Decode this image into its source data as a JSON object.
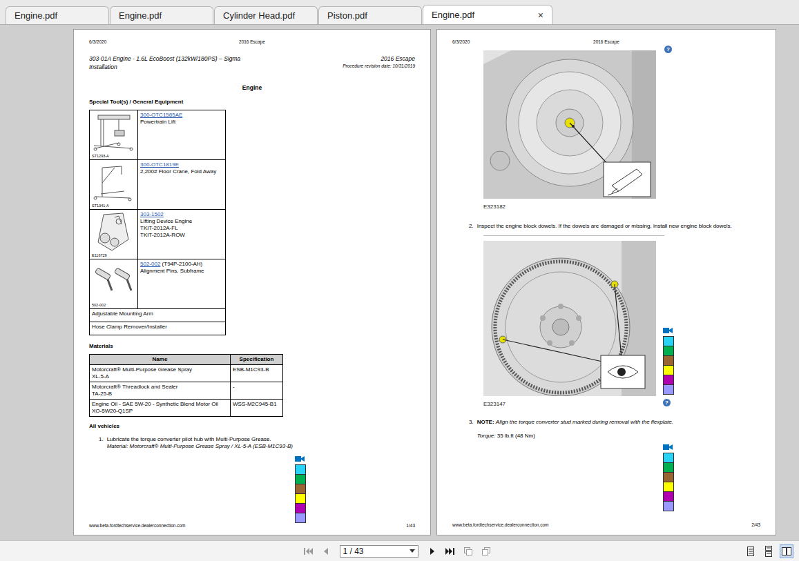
{
  "tabs": [
    {
      "label": "Engine.pdf",
      "selected": false
    },
    {
      "label": "Engine.pdf",
      "selected": false
    },
    {
      "label": "Cylinder Head.pdf",
      "selected": false
    },
    {
      "label": "Piston.pdf",
      "selected": false
    },
    {
      "label": "Engine.pdf",
      "selected": true,
      "close": "×"
    }
  ],
  "left_page": {
    "header": {
      "date": "6/3/2020",
      "center": "2016 Escape"
    },
    "title": {
      "left": [
        "303-01A Engine - 1.6L EcoBoost (132kW/180PS) – Sigma",
        "Installation"
      ],
      "right": [
        "2016 Escape",
        "Procedure revision date: 10/31/2019"
      ]
    },
    "section": "Engine",
    "tools_heading": "Special Tool(s) / General Equipment",
    "tools": [
      {
        "kind": "lift",
        "image_label": "ST1293-A",
        "link": "300-OTC1585AE",
        "link_suffix": "",
        "lines": [
          "Powertrain Lift"
        ]
      },
      {
        "kind": "crane",
        "image_label": "ST1341-A",
        "link": "300-OTC1819E",
        "link_suffix": "",
        "lines": [
          "2,200# Floor Crane, Fold Away"
        ]
      },
      {
        "kind": "bracket",
        "image_label": "E116729",
        "link": "303-1502",
        "link_suffix": "",
        "lines": [
          "Lifting Device Engine",
          "TKIT-2012A-FL",
          "TKIT-2012A-ROW"
        ]
      },
      {
        "kind": "pins",
        "image_label": "502-002",
        "link": "502-002",
        "link_suffix": " (T94P-2100-AH)",
        "lines": [
          "Alignment Pins, Subframe"
        ]
      },
      {
        "kind": "text",
        "image_label": "",
        "link": "",
        "link_suffix": "",
        "lines": [
          "Adjustable Mounting Arm"
        ]
      },
      {
        "kind": "text",
        "image_label": "",
        "link": "",
        "link_suffix": "",
        "lines": [
          "Hose Clamp Remover/Installer"
        ]
      }
    ],
    "materials_heading": "Materials",
    "materials_columns": [
      "Name",
      "Specification"
    ],
    "materials": [
      {
        "name": [
          "Motorcraft® Multi-Purpose Grease Spray",
          "XL-5-A"
        ],
        "spec": "ESB-M1C93-B"
      },
      {
        "name": [
          "Motorcraft® Threadlock and Sealer",
          "TA-25-B"
        ],
        "spec": "-"
      },
      {
        "name": [
          "Engine Oil - SAE 5W-20 - Synthetic Blend Motor Oil",
          "XO-5W20-Q1SP"
        ],
        "spec": "WSS-M2C945-B1"
      }
    ],
    "vehicles_heading": "All vehicles",
    "step": {
      "number": "1.",
      "text": "Lubricate the torque converter pilot hub with Multi-Purpose Grease.",
      "material": "Material: Motorcraft® Multi-Purpose Grease Spray / XL-5-A (ESB-M1C93-B)"
    },
    "footer": {
      "url": "www.beta.fordtechservice.dealerconnection.com",
      "page": "1/43"
    }
  },
  "right_page": {
    "header": {
      "date": "6/3/2020",
      "center": "2016 Escape"
    },
    "help": "?",
    "figures": [
      {
        "kind": "converter",
        "label": "E323182"
      },
      {
        "kind": "flywheel",
        "label": "E323147"
      }
    ],
    "step2": {
      "number": "2.",
      "text": "Inspect the engine block dowels. If the dowels are damaged or missing, install new engine block dowels."
    },
    "step3": {
      "number": "3.",
      "note_label": "NOTE:",
      "text": "Align the torque converter stud marked during removal with the flexplate.",
      "torque_label": "Torque:",
      "torque_value": "35 lb.ft (48 Nm)"
    },
    "footer": {
      "url": "www.beta.fordtechservice.dealerconnection.com",
      "page": "2/43"
    }
  },
  "color_legend": [
    "#29d3f5",
    "#00b050",
    "#996633",
    "#ffff00",
    "#b000b0",
    "#9999ff"
  ],
  "toolbar": {
    "nav_before": [
      {
        "kind": "first",
        "disabled": true
      },
      {
        "kind": "prev",
        "disabled": true
      }
    ],
    "page_field": "1 / 43",
    "nav_after": [
      {
        "kind": "next",
        "disabled": false
      },
      {
        "kind": "last",
        "disabled": false
      },
      {
        "kind": "rotate-left",
        "disabled": true
      },
      {
        "kind": "rotate-right",
        "disabled": true
      }
    ],
    "views": [
      {
        "kind": "single",
        "selected": false
      },
      {
        "kind": "continuous",
        "selected": false
      },
      {
        "kind": "facing",
        "selected": true
      }
    ]
  }
}
